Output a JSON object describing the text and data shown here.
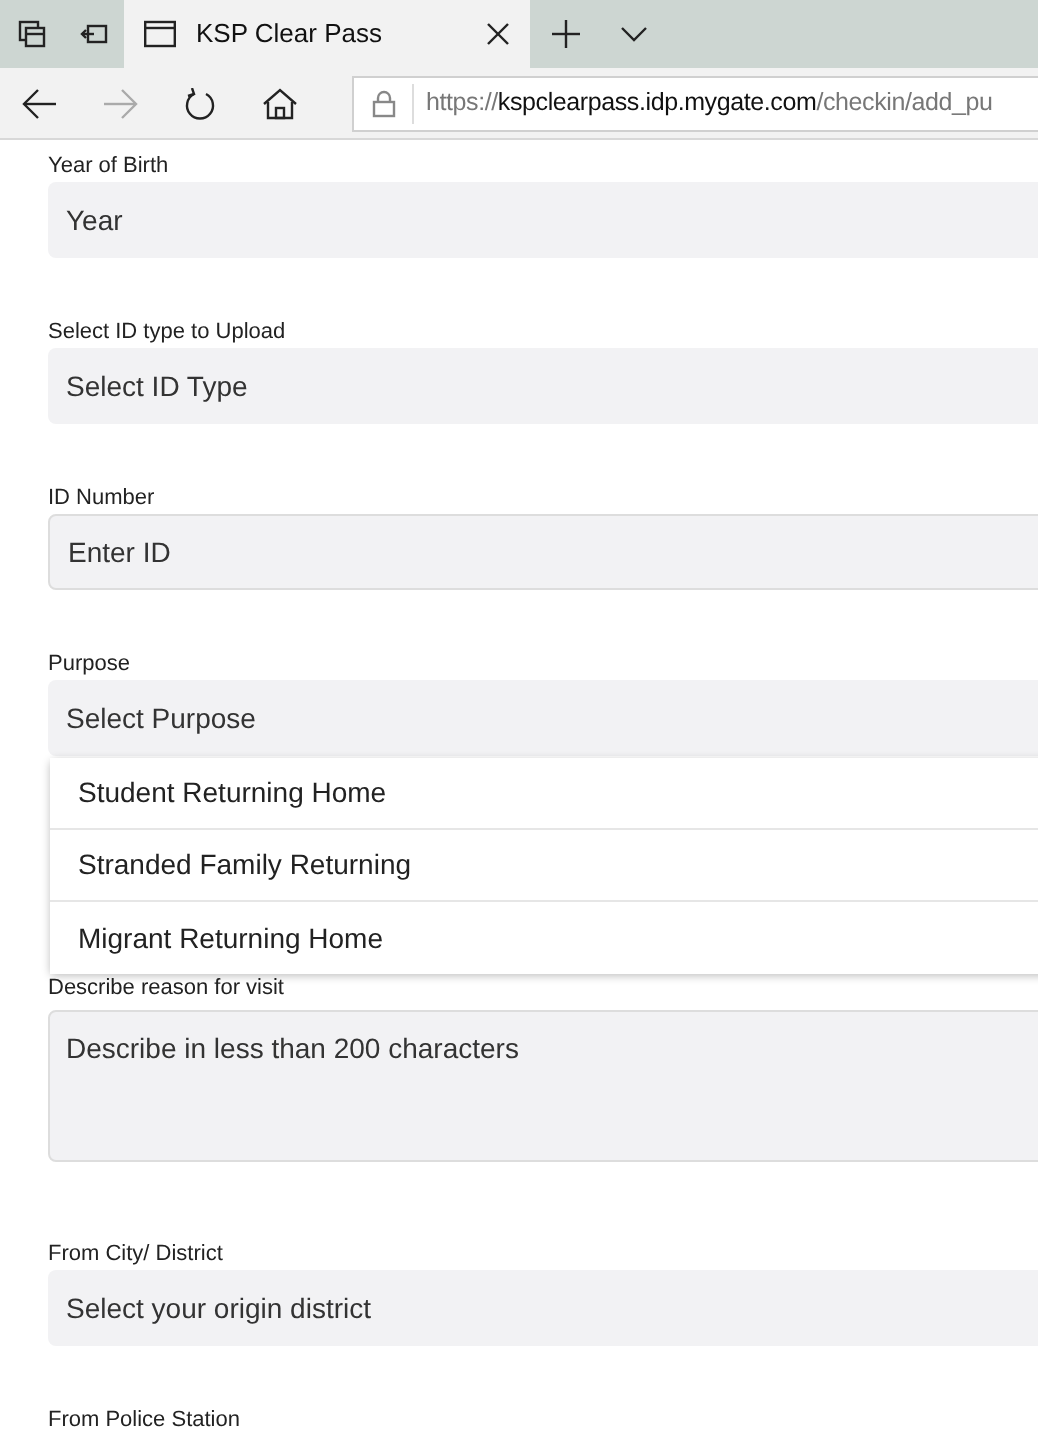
{
  "browser": {
    "tabs": [
      {
        "title": "KSP Clear Pass",
        "selected": true
      }
    ],
    "url": {
      "scheme": "https://",
      "host": "kspclearpass.idp.mygate.com",
      "path": "/checkin/add_pu"
    }
  },
  "form": {
    "fields": [
      {
        "kind": "select",
        "label": "Year of Birth",
        "value": "Year"
      },
      {
        "kind": "select",
        "label": "Select ID type to Upload",
        "value": "Select ID Type"
      },
      {
        "kind": "input",
        "label": "ID Number",
        "placeholder": "Enter ID"
      },
      {
        "kind": "select",
        "label": "Purpose",
        "value": "Select Purpose",
        "expanded": true,
        "options": [
          "Student Returning Home",
          "Stranded Family Returning",
          "Migrant Returning Home"
        ]
      },
      {
        "kind": "textarea",
        "label": "Describe reason for visit",
        "placeholder": "Describe in less than 200 characters"
      },
      {
        "kind": "select",
        "label": "From City/ District",
        "value": "Select your origin district"
      },
      {
        "kind": "label",
        "label": "From Police Station"
      }
    ]
  }
}
